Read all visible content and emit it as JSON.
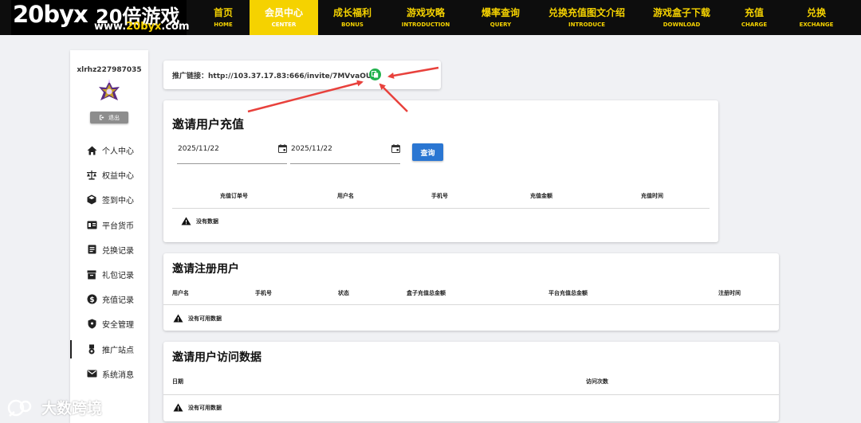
{
  "logo": {
    "big": "20byx",
    "cn": "20倍游戏",
    "url_prefix": "www.",
    "url_highlight": "20byx",
    "url_suffix": ".com"
  },
  "nav": [
    {
      "cn": "首页",
      "en": "HOME"
    },
    {
      "cn": "会员中心",
      "en": "CENTER"
    },
    {
      "cn": "成长福利",
      "en": "BONUS"
    },
    {
      "cn": "游戏攻略",
      "en": "INTRODUCTION"
    },
    {
      "cn": "爆率查询",
      "en": "QUERY"
    },
    {
      "cn": "兑换充值图文介绍",
      "en": "INTRODUCE"
    },
    {
      "cn": "游戏盒子下载",
      "en": "DOWNLOAD"
    },
    {
      "cn": "充值",
      "en": "CHARGE"
    },
    {
      "cn": "兑换",
      "en": "EXCHANGE"
    }
  ],
  "sidebar": {
    "username": "xlrhz227987035",
    "logout_label": "退出",
    "items": [
      {
        "label": "个人中心",
        "icon": "home-icon"
      },
      {
        "label": "权益中心",
        "icon": "scale-icon"
      },
      {
        "label": "签到中心",
        "icon": "cube-icon"
      },
      {
        "label": "平台货币",
        "icon": "currency-card-icon"
      },
      {
        "label": "兑换记录",
        "icon": "document-icon"
      },
      {
        "label": "礼包记录",
        "icon": "archive-icon"
      },
      {
        "label": "充值记录",
        "icon": "dollar-circle-icon"
      },
      {
        "label": "安全管理",
        "icon": "shield-icon"
      },
      {
        "label": "推广站点",
        "icon": "medal-icon"
      },
      {
        "label": "系统消息",
        "icon": "mail-icon"
      }
    ]
  },
  "promo": {
    "label": "推广链接：",
    "url": "http://103.37.17.83:666/invite/7MVvaOUf"
  },
  "recharge": {
    "title": "邀请用户充值",
    "start_date": "2025/11/22",
    "end_date": "2025/11/22",
    "query_label": "查询",
    "columns": [
      "充值订单号",
      "用户名",
      "手机号",
      "充值金额",
      "充值时间"
    ],
    "empty": "没有数据"
  },
  "register": {
    "title": "邀请注册用户",
    "columns": [
      "用户名",
      "手机号",
      "状态",
      "盒子充值总金额",
      "平台充值总金额",
      "注册时间"
    ],
    "empty": "没有可用数据"
  },
  "visits": {
    "title": "邀请用户访问数据",
    "columns": [
      "日期",
      "访问次数"
    ],
    "empty": "没有可用数据"
  },
  "watermark": "大数跨境",
  "colors": {
    "accent": "#f5d200",
    "header": "#0d0d0d",
    "query": "#2a76d2",
    "copy": "#21b14c",
    "arrow": "#e8413c"
  }
}
